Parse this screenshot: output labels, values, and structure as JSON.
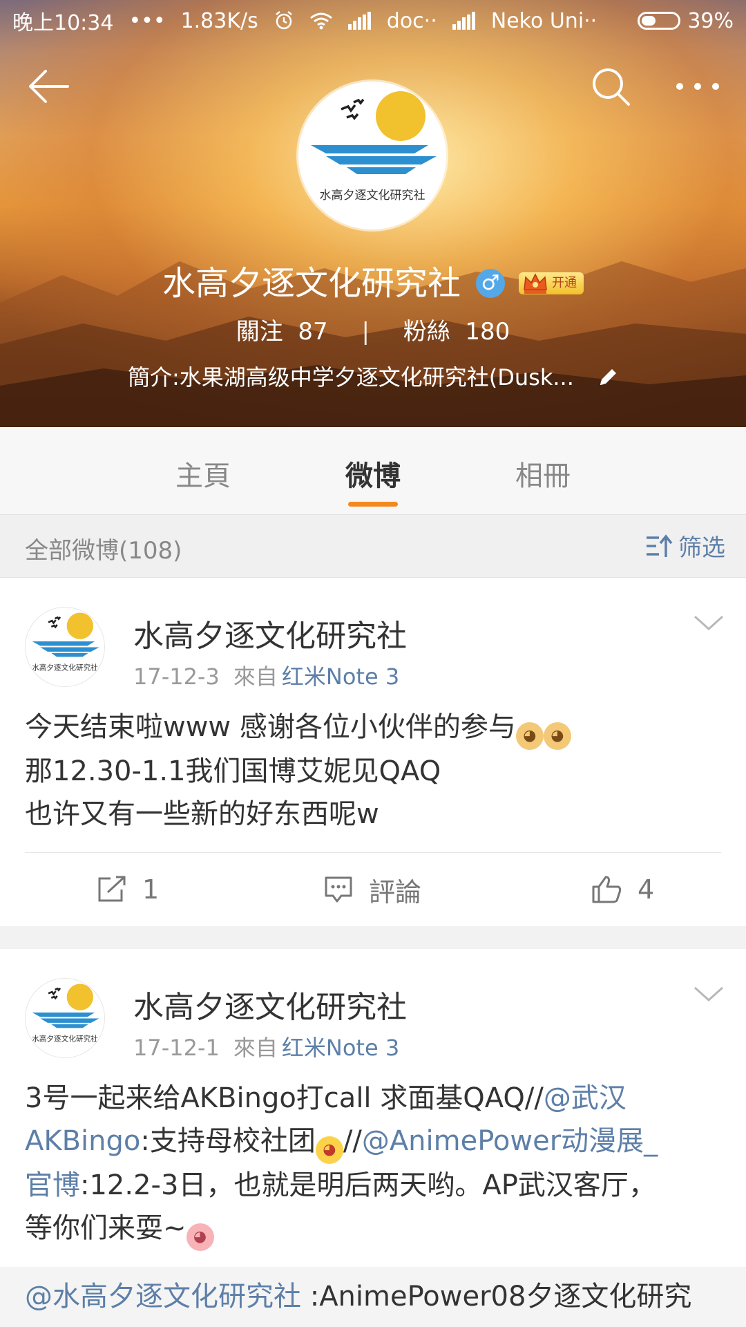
{
  "statusbar": {
    "time": "晚上10:34",
    "dots": "•••",
    "speed": "1.83K/s",
    "carrier1": "doc··",
    "carrier2": "Neko Uni··",
    "battery": "39%",
    "battery_level": 0.39
  },
  "profile": {
    "name": "水高夕逐文化研究社",
    "gender_symbol": "♂",
    "vip_label": "开通",
    "avatar_text": "水高夕逐文化研究社",
    "follow_label": "關注",
    "follow_count": "87",
    "separator": "|",
    "fans_label": "粉絲",
    "fans_count": "180",
    "bio": "簡介:水果湖高级中学夕逐文化研究社(Dusk..."
  },
  "tabs": [
    {
      "label": "主頁",
      "active": false
    },
    {
      "label": "微博",
      "active": true
    },
    {
      "label": "相冊",
      "active": false
    }
  ],
  "filterbar": {
    "count": "全部微博(108)",
    "filter_label": "筛选"
  },
  "posts": [
    {
      "author": "水高夕逐文化研究社",
      "date": "17-12-3",
      "source_label": "來自",
      "device": "红米Note 3",
      "lines": [
        "今天结束啦www 感谢各位小伙伴的参与",
        "那12.30-1.1我们国博艾妮见QAQ",
        "也许又有一些新的好东西呢w"
      ],
      "emoji": "dog",
      "repost_count": "1",
      "comment_label": "評論",
      "like_count": "4"
    },
    {
      "author": "水高夕逐文化研究社",
      "date": "17-12-1",
      "source_label": "來自",
      "device": "红米Note 3",
      "segments": {
        "t1": "3号一起来给AKBingo打call 求面基QAQ//",
        "l1": "@武汉",
        "l2": "AKBingo",
        "t2": ":支持母校社团",
        "t3": "//",
        "l3": "@AnimePower动漫展_",
        "l4": "官博",
        "t4": ":12.2-3日，也就是明后两天哟。AP武汉客厅，",
        "t5": "等你们来耍~"
      },
      "retweet_mention": "@水高夕逐文化研究社",
      "retweet_text": " :AnimePower08夕逐文化研究"
    }
  ],
  "colors": {
    "accent_orange": "#f48a1f",
    "link_blue": "#5d7fa8",
    "gender_blue": "#55a8e8",
    "vip_gold": "#f2c02a"
  }
}
